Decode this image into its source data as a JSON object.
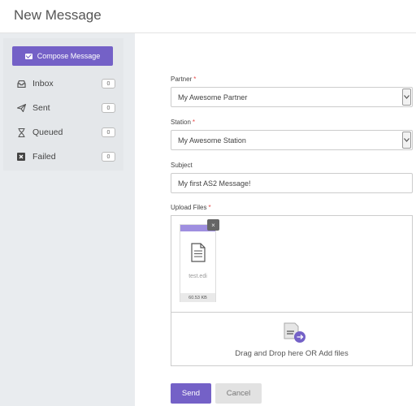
{
  "header": {
    "title": "New Message"
  },
  "sidebar": {
    "compose_label": "Compose Message",
    "items": [
      {
        "label": "Inbox",
        "count": "0",
        "icon": "inbox-icon"
      },
      {
        "label": "Sent",
        "count": "0",
        "icon": "paper-plane-icon"
      },
      {
        "label": "Queued",
        "count": "0",
        "icon": "hourglass-icon"
      },
      {
        "label": "Failed",
        "count": "0",
        "icon": "failed-x-icon"
      }
    ]
  },
  "form": {
    "partner": {
      "label": "Partner",
      "required": "*",
      "value": "My Awesome Partner"
    },
    "station": {
      "label": "Station",
      "required": "*",
      "value": "My Awesome Station"
    },
    "subject": {
      "label": "Subject",
      "value": "My first AS2 Message!"
    },
    "upload": {
      "label": "Upload Files",
      "required": "*",
      "file": {
        "name": "test.edi",
        "size": "60.53 KB",
        "remove": "×"
      },
      "drop_text": "Drag and Drop here OR Add files"
    }
  },
  "actions": {
    "send": "Send",
    "cancel": "Cancel"
  },
  "colors": {
    "accent": "#7461c7",
    "file_bar": "#9f8fe0",
    "required": "#e84a4a"
  }
}
